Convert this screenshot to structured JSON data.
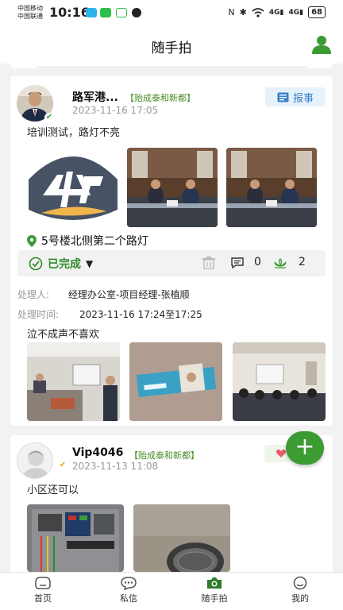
{
  "status_bar": {
    "carrier_1": "中国移动",
    "carrier_2": "中国联通",
    "time": "10:16",
    "battery": "68",
    "net_1": "4G",
    "net_2": "4G"
  },
  "header": {
    "title": "随手拍",
    "profile_icon": "person-icon"
  },
  "posts": [
    {
      "username": "路军港...",
      "community": "【贻成泰和新都】",
      "timestamp": "2023-11-16 17:05",
      "report_label": "报事",
      "text": "培训测试，路灯不亮",
      "location": "5号楼北侧第二个路灯",
      "status": "已完成",
      "comment_count": "0",
      "like_count": "2",
      "handler_label": "处理人:",
      "handler_value": "经理办公室-项目经理-张植顺",
      "handle_time_label": "处理时间:",
      "handle_time_value": "2023-11-16 17:24至17:25",
      "handle_note": "泣不成声不喜欢"
    },
    {
      "username": "Vip4046",
      "community": "【贻成泰和新都】",
      "timestamp": "2023-11-13 11:08",
      "text": "小区还可以"
    }
  ],
  "fab": {
    "label": "+"
  },
  "tabbar": {
    "items": [
      {
        "label": "首页",
        "icon": "home-icon"
      },
      {
        "label": "私信",
        "icon": "message-icon"
      },
      {
        "label": "随手拍",
        "icon": "camera-icon"
      },
      {
        "label": "我的",
        "icon": "profile-icon"
      }
    ]
  },
  "colors": {
    "accent": "#3d9b34",
    "community": "#4a8c2a",
    "report": "#3a7ec6",
    "muted": "#999999"
  }
}
